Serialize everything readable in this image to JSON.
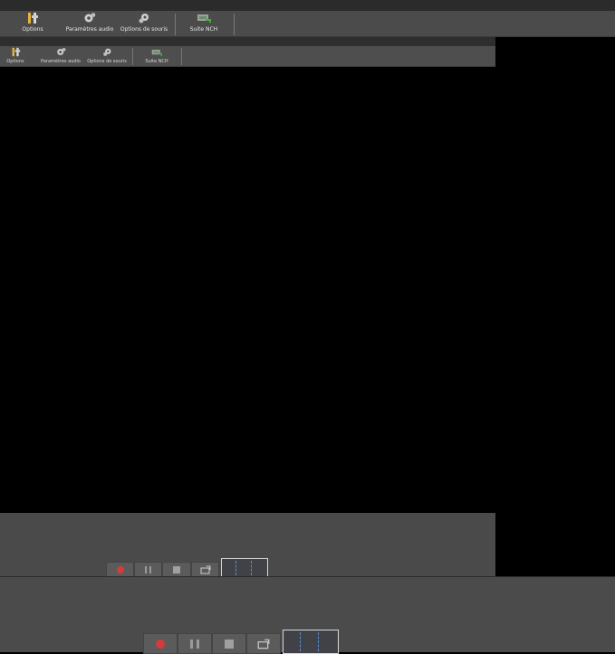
{
  "toolbar": {
    "items": [
      {
        "label": "Options",
        "icon": "options-icon"
      },
      {
        "label": "Paramètres audio",
        "icon": "audio-settings-icon"
      },
      {
        "label": "Options de souris",
        "icon": "mouse-options-icon"
      },
      {
        "label": "Suite NCH",
        "icon": "nch-suite-icon"
      }
    ]
  },
  "inner_toolbar": {
    "items": [
      {
        "label": "Options",
        "icon": "options-icon"
      },
      {
        "label": "Paramètres audio",
        "icon": "audio-settings-icon"
      },
      {
        "label": "Options de souris",
        "icon": "mouse-options-icon"
      },
      {
        "label": "Suite NCH",
        "icon": "nch-suite-icon"
      }
    ]
  },
  "controls": {
    "record": "record-icon",
    "pause": "pause-icon",
    "stop": "stop-icon",
    "snapshot": "snapshot-icon"
  },
  "colors": {
    "toolbar_bg": "#4b4b4b",
    "record_red": "#d63b3b",
    "preview_dash": "#5b8ccf"
  }
}
